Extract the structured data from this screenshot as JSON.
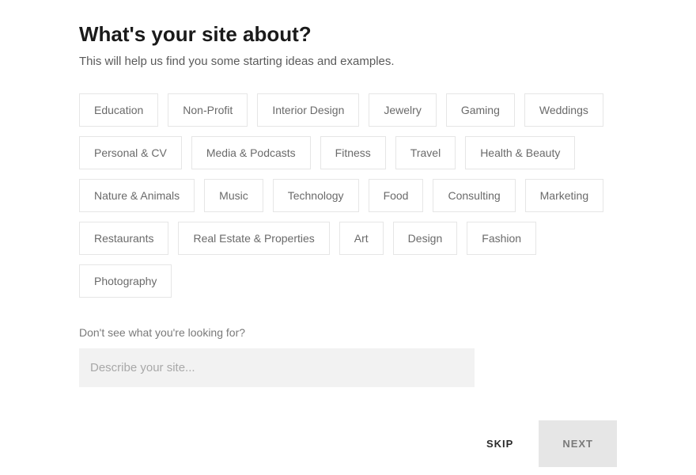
{
  "header": {
    "title": "What's your site about?",
    "subtitle": "This will help us find you some starting ideas and examples."
  },
  "topics": [
    "Education",
    "Non-Profit",
    "Interior Design",
    "Jewelry",
    "Gaming",
    "Weddings",
    "Personal & CV",
    "Media & Podcasts",
    "Fitness",
    "Travel",
    "Health & Beauty",
    "Nature & Animals",
    "Music",
    "Technology",
    "Food",
    "Consulting",
    "Marketing",
    "Restaurants",
    "Real Estate & Properties",
    "Art",
    "Design",
    "Fashion",
    "Photography"
  ],
  "custom": {
    "prompt": "Don't see what you're looking for?",
    "placeholder": "Describe your site..."
  },
  "footer": {
    "skip_label": "SKIP",
    "next_label": "NEXT"
  }
}
